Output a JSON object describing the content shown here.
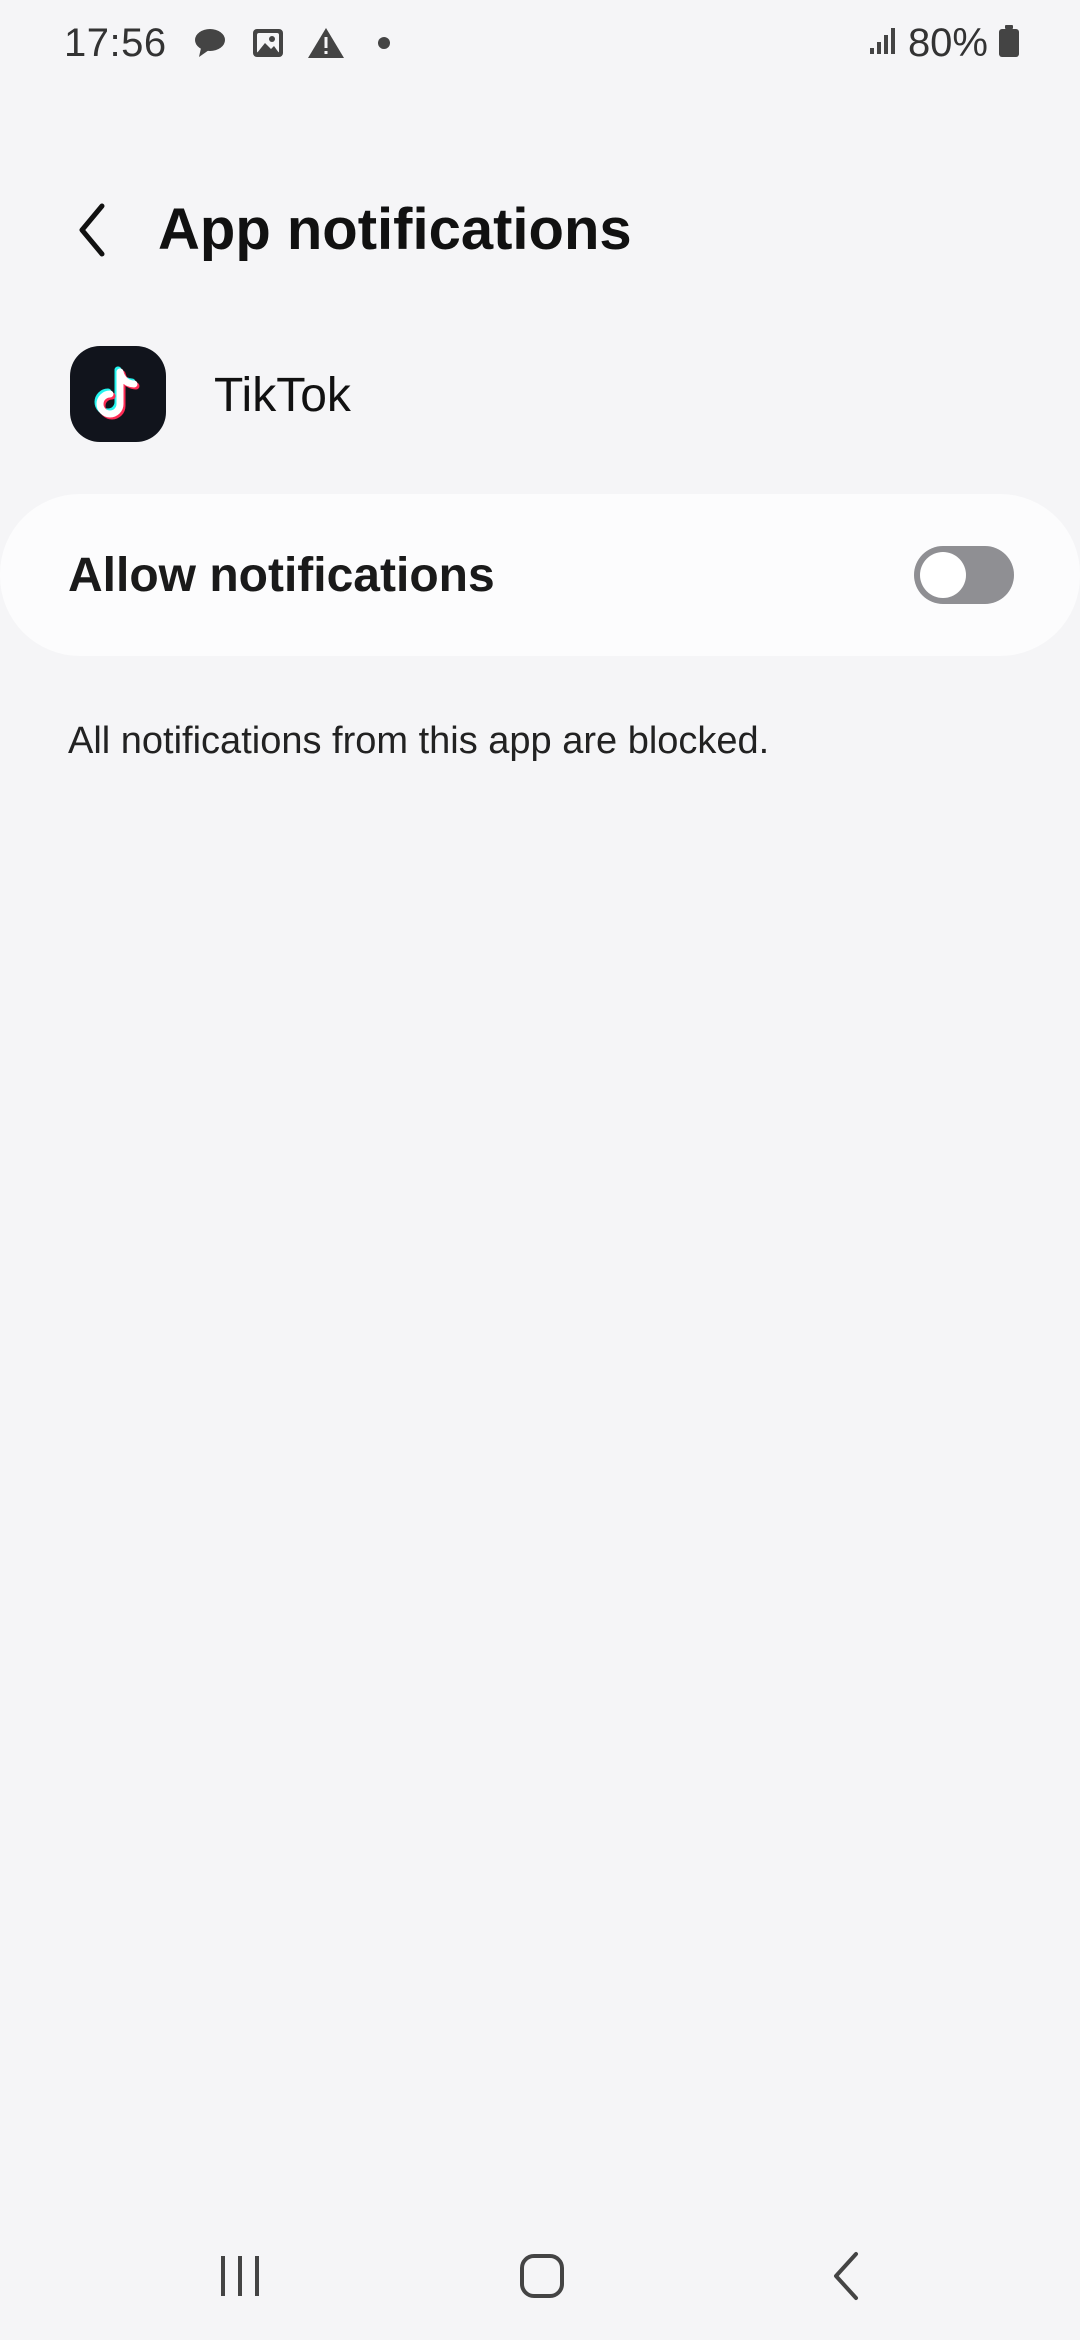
{
  "status_bar": {
    "time": "17:56",
    "battery": "80%",
    "left_icons": [
      "chat-bubble-icon",
      "image-icon",
      "warning-icon",
      "dot-icon"
    ],
    "right_icons": [
      "signal-icon",
      "battery-icon"
    ]
  },
  "header": {
    "title": "App notifications",
    "back_icon": "chevron-left-icon"
  },
  "app": {
    "name": "TikTok",
    "icon": "tiktok-icon"
  },
  "allow_notifications": {
    "label": "Allow notifications",
    "enabled": false
  },
  "info_text": "All notifications from this app are blocked.",
  "nav_bar": {
    "buttons": [
      "recents-icon",
      "home-icon",
      "back-icon"
    ]
  },
  "colors": {
    "background": "#f5f5f7",
    "card": "#fcfcfd",
    "toggle_off": "#8f8f93",
    "app_icon_bg": "#11141c",
    "tiktok_cyan": "#25f4ee",
    "tiktok_pink": "#fe2c55"
  }
}
